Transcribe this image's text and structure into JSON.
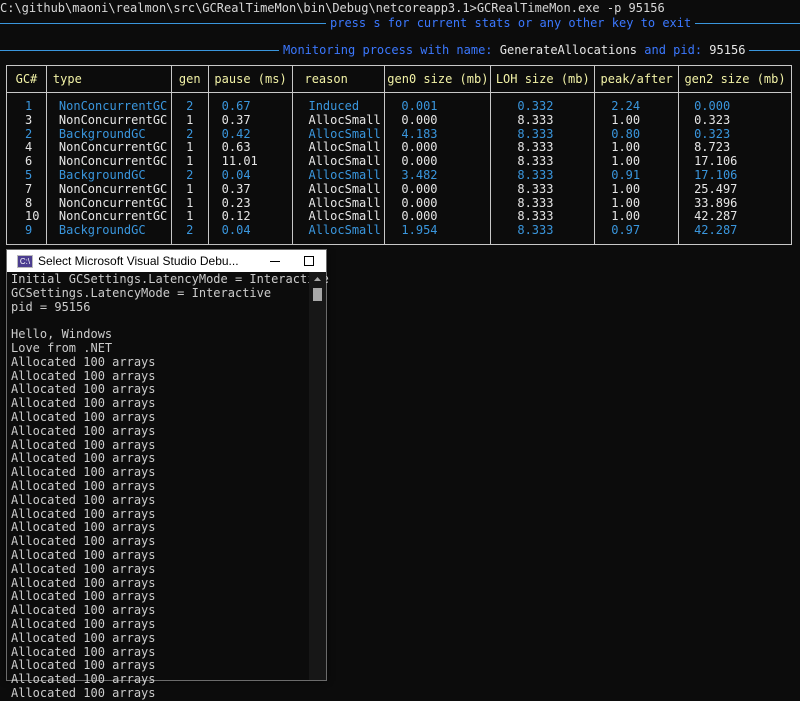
{
  "main_console": {
    "command_line": "C:\\github\\maoni\\realmon\\src\\GCRealTimeMon\\bin\\Debug\\netcoreapp3.1>GCRealTimeMon.exe -p 95156",
    "prompt_line": "press s for current stats or any other key to exit",
    "monitor_prefix": "Monitoring process with name:",
    "process_name": "GenerateAllocations",
    "pid_label": "and pid:",
    "pid": "95156"
  },
  "gc_table": {
    "headers": [
      "GC#",
      "type",
      "gen",
      "pause (ms)",
      "reason",
      "gen0 size (mb)",
      "LOH size (mb)",
      "peak/after",
      "gen2 size (mb)"
    ],
    "rows": [
      {
        "gc": "1",
        "type": "NonConcurrentGC",
        "gen": "2",
        "pause": "0.67",
        "reason": "Induced",
        "gen0": "0.001",
        "loh": "0.332",
        "peak": "2.24",
        "gen2": "0.000",
        "gen2_row": true
      },
      {
        "gc": "3",
        "type": "NonConcurrentGC",
        "gen": "1",
        "pause": "0.37",
        "reason": "AllocSmall",
        "gen0": "0.000",
        "loh": "8.333",
        "peak": "1.00",
        "gen2": "0.323",
        "gen2_row": false
      },
      {
        "gc": "2",
        "type": "BackgroundGC",
        "gen": "2",
        "pause": "0.42",
        "reason": "AllocSmall",
        "gen0": "4.183",
        "loh": "8.333",
        "peak": "0.80",
        "gen2": "0.323",
        "gen2_row": true
      },
      {
        "gc": "4",
        "type": "NonConcurrentGC",
        "gen": "1",
        "pause": "0.63",
        "reason": "AllocSmall",
        "gen0": "0.000",
        "loh": "8.333",
        "peak": "1.00",
        "gen2": "8.723",
        "gen2_row": false
      },
      {
        "gc": "6",
        "type": "NonConcurrentGC",
        "gen": "1",
        "pause": "11.01",
        "reason": "AllocSmall",
        "gen0": "0.000",
        "loh": "8.333",
        "peak": "1.00",
        "gen2": "17.106",
        "gen2_row": false
      },
      {
        "gc": "5",
        "type": "BackgroundGC",
        "gen": "2",
        "pause": "0.04",
        "reason": "AllocSmall",
        "gen0": "3.482",
        "loh": "8.333",
        "peak": "0.91",
        "gen2": "17.106",
        "gen2_row": true
      },
      {
        "gc": "7",
        "type": "NonConcurrentGC",
        "gen": "1",
        "pause": "0.37",
        "reason": "AllocSmall",
        "gen0": "0.000",
        "loh": "8.333",
        "peak": "1.00",
        "gen2": "25.497",
        "gen2_row": false
      },
      {
        "gc": "8",
        "type": "NonConcurrentGC",
        "gen": "1",
        "pause": "0.23",
        "reason": "AllocSmall",
        "gen0": "0.000",
        "loh": "8.333",
        "peak": "1.00",
        "gen2": "33.896",
        "gen2_row": false
      },
      {
        "gc": "10",
        "type": "NonConcurrentGC",
        "gen": "1",
        "pause": "0.12",
        "reason": "AllocSmall",
        "gen0": "0.000",
        "loh": "8.333",
        "peak": "1.00",
        "gen2": "42.287",
        "gen2_row": false
      },
      {
        "gc": "9",
        "type": "BackgroundGC",
        "gen": "2",
        "pause": "0.04",
        "reason": "AllocSmall",
        "gen0": "1.954",
        "loh": "8.333",
        "peak": "0.97",
        "gen2": "42.287",
        "gen2_row": true
      }
    ]
  },
  "debug_console": {
    "window_title": "Select Microsoft Visual Studio Debu...",
    "app_icon_text": "C:\\",
    "lines": [
      "Initial GCSettings.LatencyMode = Interactive",
      "GCSettings.LatencyMode = Interactive",
      "pid = 95156",
      "",
      "Hello, Windows",
      "Love from .NET",
      "Allocated 100 arrays",
      "Allocated 100 arrays",
      "Allocated 100 arrays",
      "Allocated 100 arrays",
      "Allocated 100 arrays",
      "Allocated 100 arrays",
      "Allocated 100 arrays",
      "Allocated 100 arrays",
      "Allocated 100 arrays",
      "Allocated 100 arrays",
      "Allocated 100 arrays",
      "Allocated 100 arrays",
      "Allocated 100 arrays",
      "Allocated 100 arrays",
      "Allocated 100 arrays",
      "Allocated 100 arrays",
      "Allocated 100 arrays",
      "Allocated 100 arrays",
      "Allocated 100 arrays",
      "Allocated 100 arrays",
      "Allocated 100 arrays",
      "Allocated 100 arrays",
      "Allocated 100 arrays",
      "Allocated 100 arrays",
      "Allocated 100 arrays"
    ]
  },
  "colors": {
    "background": "#0c0c0c",
    "accent_blue": "#3a96dd",
    "header_yellow": "#f2f2a6",
    "text": "#cccccc"
  }
}
